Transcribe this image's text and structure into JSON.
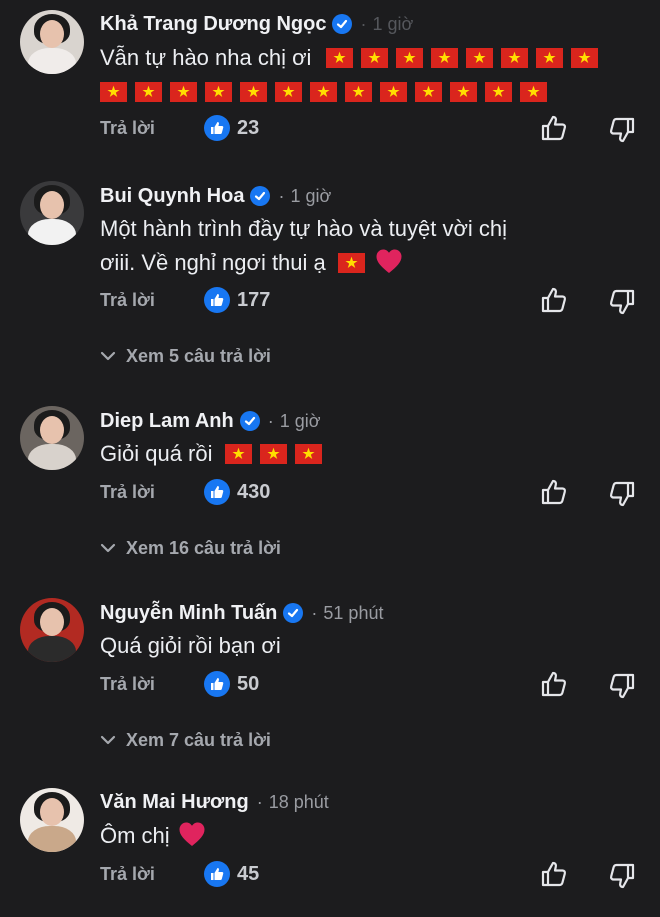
{
  "comments": [
    {
      "name": "Khả Trang Dương Ngọc",
      "time": "1 giờ",
      "text": "Vẫn tự hào nha chị ơi",
      "flags_line1": 8,
      "flags_line2": 13,
      "reply_label": "Trả lời",
      "likes": "23",
      "avatar_colors": {
        "bg": "#d9d4cf",
        "body": "#f0ecea"
      }
    },
    {
      "name": "Bui Quynh Hoa",
      "time": "1 giờ",
      "text_line1": "Một hành trình đầy tự hào và tuyệt vời chị",
      "text_line2": "ơiii. Về nghỉ ngơi thui ạ",
      "reply_label": "Trả lời",
      "likes": "177",
      "view_replies": "Xem 5 câu trả lời",
      "avatar_colors": {
        "bg": "#3a3a3c",
        "body": "#f2f2f2"
      }
    },
    {
      "name": "Diep Lam Anh",
      "time": "1 giờ",
      "text": "Giỏi quá rồi",
      "reply_label": "Trả lời",
      "likes": "430",
      "view_replies": "Xem 16 câu trả lời",
      "avatar_colors": {
        "bg": "#6b6560",
        "body": "#d8d2cc"
      }
    },
    {
      "name": "Nguyễn Minh Tuấn",
      "time": "51 phút",
      "text": "Quá giỏi rồi bạn ơi",
      "reply_label": "Trả lời",
      "likes": "50",
      "view_replies": "Xem 7 câu trả lời",
      "avatar_colors": {
        "bg": "#b22a22",
        "body": "#2b2b2b"
      }
    },
    {
      "name": "Văn Mai Hương",
      "time": "18 phút",
      "text": "Ôm chị",
      "reply_label": "Trả lời",
      "likes": "45",
      "avatar_colors": {
        "bg": "#efeae5",
        "body": "#c9a88a"
      }
    }
  ],
  "colors": {
    "background": "#1c1c1e",
    "verified": "#1877f2",
    "flag_red": "#da251d",
    "flag_star": "#ffde00",
    "heart": "#e0245e"
  },
  "icons": {
    "verified": "verified-badge-icon",
    "like": "thumbs-up-icon",
    "dislike": "thumbs-down-icon",
    "expand": "chevron-down-icon",
    "flag": "vietnam-flag-icon",
    "heart": "red-heart-icon"
  }
}
